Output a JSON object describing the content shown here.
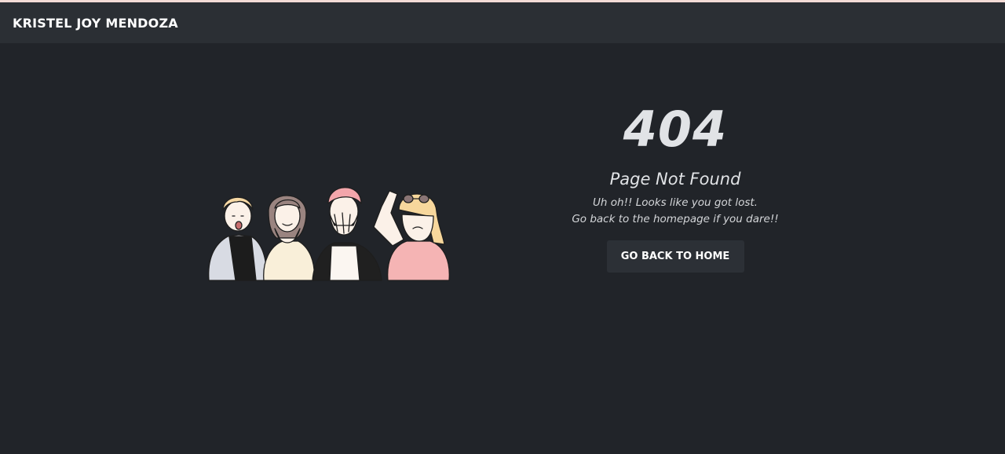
{
  "navbar": {
    "brand": "KRISTEL JOY MENDOZA"
  },
  "error": {
    "code": "404",
    "title": "Page Not Found",
    "message_line1": "Uh oh!! Looks like you got lost.",
    "message_line2": "Go back to the homepage if you dare!!",
    "button_label": "GO BACK TO HOME"
  },
  "colors": {
    "background": "#212429",
    "navbar": "#2b2f34",
    "top_strip": "#f3dcd6",
    "button": "#2c3036",
    "text_light": "#e1e3e6"
  },
  "illustration": {
    "icon": "shocked-people-illustration"
  }
}
